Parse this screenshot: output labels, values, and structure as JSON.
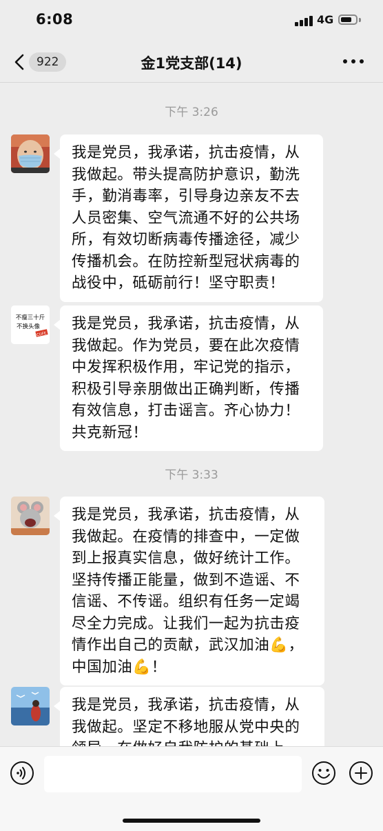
{
  "status_bar": {
    "time": "6:08",
    "network": "4G",
    "battery_level": 0.75
  },
  "nav": {
    "back_count": "922",
    "title": "金1党支部(14)"
  },
  "chat": {
    "time_separators": [
      "下午 3:26",
      "下午 3:33"
    ],
    "messages": [
      {
        "avatar": "man-with-mask-avatar",
        "text": "我是党员，我承诺，抗击疫情，从我做起。带头提高防护意识，勤洗手，勤消毒率，引导身边亲友不去人员密集、空气流通不好的公共场所，有效切断病毒传播途径，减少传播机会。在防控新型冠状病毒的战役中，砥砺前行！坚守职责！"
      },
      {
        "avatar": "text-sticker-avatar",
        "avatar_text": [
          "不瘦三十斤",
          "不换头像"
        ],
        "avatar_tag": "CUFE",
        "text": "我是党员，我承诺，抗击疫情，从我做起。作为党员，要在此次疫情中发挥积极作用，牢记党的指示，积极引导亲朋做出正确判断，传播有效信息，打击谣言。齐心协力！共克新冠！"
      },
      {
        "avatar": "cartoon-mouse-avatar",
        "text": "我是党员，我承诺，抗击疫情，从我做起。在疫情的排查中，一定做到上报真实信息，做好统计工作。坚持传播正能量，做到不造谣、不信谣、不传谣。组织有任务一定竭尽全力完成。让我们一起为抗击疫情作出自己的贡献，武汉加油💪，中国加油💪！"
      },
      {
        "avatar": "seaside-photo-avatar",
        "text": "我是党员，我承诺，抗击疫情，从我做起。坚定不移地服从党中央的领导，在做好自我防护的基础上"
      }
    ]
  },
  "input_bar": {
    "placeholder": ""
  },
  "colors": {
    "background": "#ededed",
    "bubble": "#ffffff",
    "timestamp": "#9a9a9a"
  }
}
